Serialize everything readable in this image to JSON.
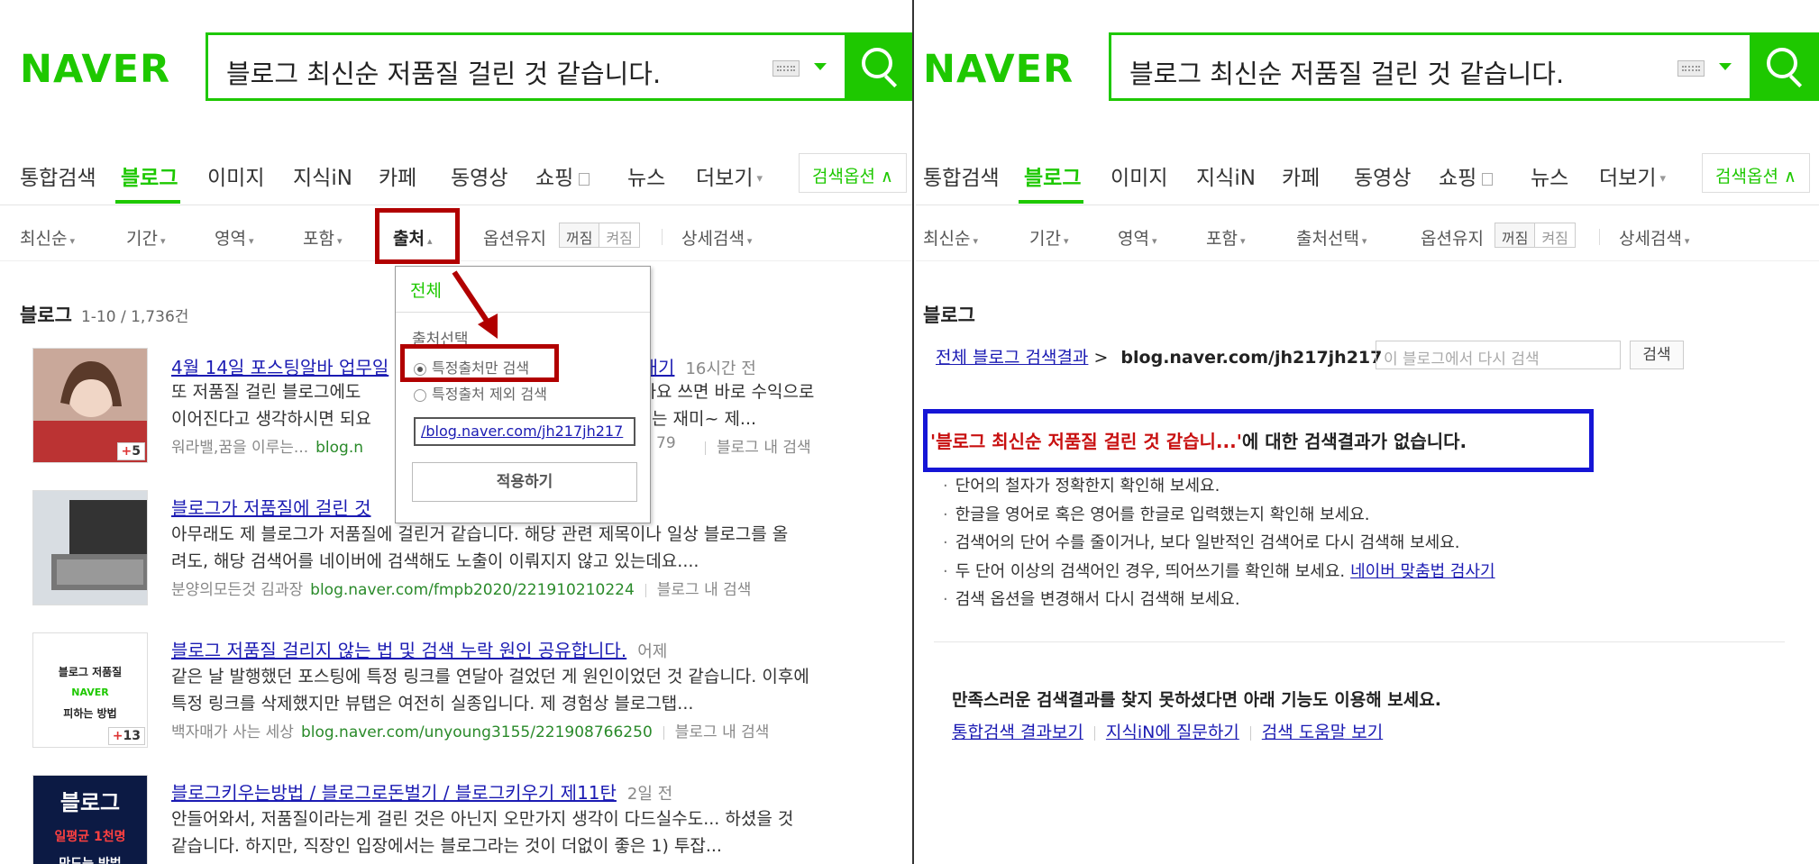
{
  "left": {
    "logo": "NAVER",
    "query": "블로그 최신순 저품질 걸린 것 같습니다.",
    "tabs": [
      "통합검색",
      "블로그",
      "이미지",
      "지식iN",
      "카페",
      "동영상",
      "쇼핑",
      "뉴스",
      "더보기"
    ],
    "option_button": "검색옵션",
    "filters": {
      "sort": "최신순",
      "period": "기간",
      "area": "영역",
      "include": "포함",
      "source": "출처",
      "keep": "옵션유지",
      "off": "꺼짐",
      "on": "켜짐",
      "detail": "상세검색"
    },
    "section": {
      "title": "블로그",
      "count": "1-10 / 1,736건"
    },
    "dropdown": {
      "all": "전체",
      "select": "출처선택",
      "radio1": "특정출처만 검색",
      "radio2": "특정출처 제외 검색",
      "input_value": "/blog.naver.com/jh217jh217",
      "apply": "적용하기"
    },
    "items": [
      {
        "title_a": "4월 14일 포스팅알바 업무일",
        "title_b": "일내기",
        "time": "16시간 전",
        "desc1": "또 저품질 걸린 블로그에도",
        "desc1b": "니까요 쓰면 바로 수익으로",
        "desc2": "이어진다고 생각하시면 되요",
        "desc2b": "는 재미~ 제...",
        "author": "워라밸,꿈을 이루는...",
        "url": "blog.n",
        "url_tail": "79",
        "more": "블로그 내 검색",
        "badge": "5"
      },
      {
        "title": "블로그가 저품질에 걸린 것",
        "desc1": "아무래도 제 블로그가 저품질에 걸린거 같습니다. 해당 관련 제목이나 일상 블로그를 올",
        "desc2": "려도, 해당 검색어를 네이버에 검색해도 노출이 이뤄지지 않고 있는데요....",
        "author": "분양의모든것 김과장",
        "url": "blog.naver.com/fmpb2020/221910210224",
        "more": "블로그 내 검색"
      },
      {
        "title": "블로그 저품질 걸리지 않는 법 및 검색 누락 원인 공유합니다.",
        "time": "어제",
        "desc1": "같은 날 발행했던 포스팅에 특정 링크를 연달아 걸었던 게 원인이었던 것 같습니다. 이후에",
        "desc2": "특정 링크를 삭제했지만 뷰탭은 여전히 실종입니다. 제 경험상 블로그탭...",
        "author": "백자매가 사는 세상",
        "url": "blog.naver.com/unyoung3155/221908766250",
        "more": "블로그 내 검색",
        "thumb1": "블로그 저품질",
        "thumb2": "NAVER",
        "thumb3": "피하는 방법",
        "badge": "13"
      },
      {
        "title": "블로그키우는방법 / 블로그로돈벌기 / 블로그키우기 제11탄",
        "time": "2일 전",
        "desc1": "안들어와서, 저품질이라는게 걸린 것은 아닌지 오만가지 생각이 다드실수도... 하셨을 것",
        "desc2": "같습니다. 하지만, 직장인 입장에서는 블로그라는 것이 더없이 좋은 1) 투잡...",
        "thumb1": "블로그",
        "thumb2": "일평균 1천명",
        "thumb3": "만드는 방법"
      }
    ]
  },
  "right": {
    "logo": "NAVER",
    "query": "블로그 최신순 저품질 걸린 것 같습니다.",
    "tabs": [
      "통합검색",
      "블로그",
      "이미지",
      "지식iN",
      "카페",
      "동영상",
      "쇼핑",
      "뉴스",
      "더보기"
    ],
    "option_button": "검색옵션",
    "filters": {
      "sort": "최신순",
      "period": "기간",
      "area": "영역",
      "include": "포함",
      "source": "출처선택",
      "keep": "옵션유지",
      "off": "꺼짐",
      "on": "켜짐",
      "detail": "상세검색"
    },
    "section_title": "블로그",
    "breadcrumb": {
      "link": "전체 블로그 검색결과",
      "sep": ">",
      "domain": "blog.naver.com/jh217jh217",
      "placeholder": "이 블로그에서 다시 검색",
      "button": "검색"
    },
    "no_result": {
      "query": "'블로그 최신순 저품질 걸린 것 같습니...'",
      "text": "에 대한 검색결과가 없습니다."
    },
    "tips": [
      "단어의 철자가 정확한지 확인해 보세요.",
      "한글을 영어로 혹은 영어를 한글로 입력했는지 확인해 보세요.",
      "검색어의 단어 수를 줄이거나, 보다 일반적인 검색어로 다시 검색해 보세요.",
      "두 단어 이상의 검색어인 경우, 띄어쓰기를 확인해 보세요.",
      "검색 옵션을 변경해서 다시 검색해 보세요."
    ],
    "spell_link": "네이버 맞춤법 검사기",
    "more_title": "만족스러운 검색결과를 찾지 못하셨다면 아래 기능도 이용해 보세요.",
    "more_links": [
      "통합검색 결과보기",
      "지식iN에 질문하기",
      "검색 도움말 보기"
    ]
  },
  "colors": {
    "brand": "#1ec800",
    "link": "#1b1bb3",
    "highlight_red": "#b10000",
    "highlight_blue": "#1515d6"
  }
}
